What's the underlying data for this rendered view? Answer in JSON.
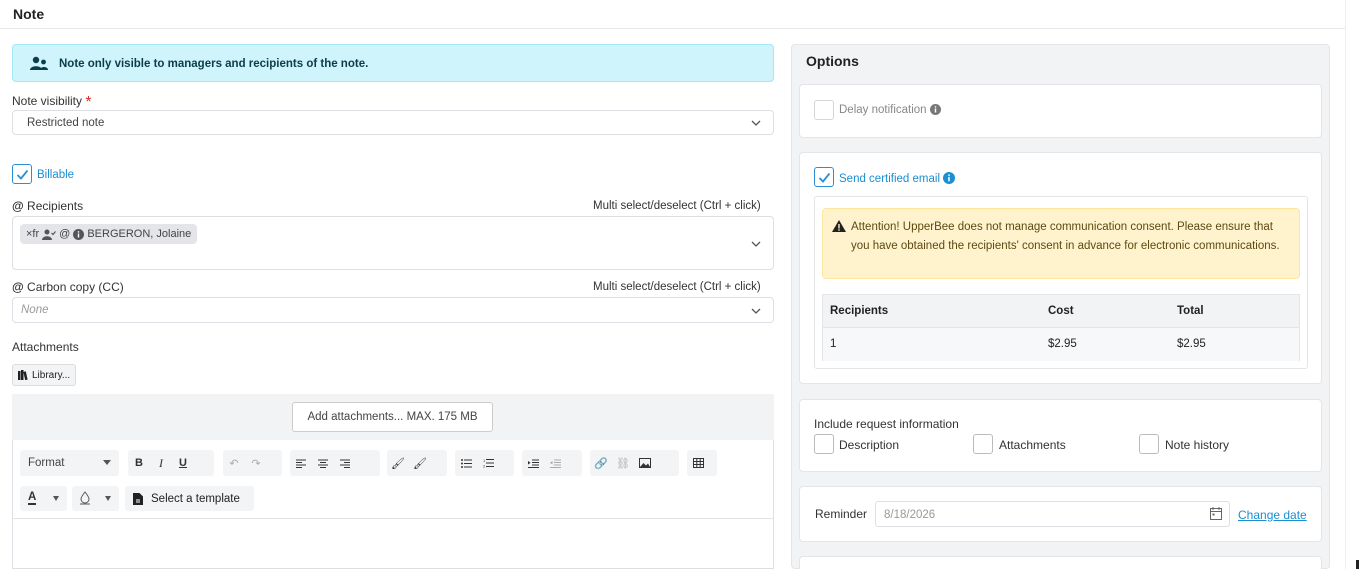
{
  "header": {
    "title": "Note"
  },
  "info_alert": {
    "text": "Note only visible to managers and recipients of the note."
  },
  "visibility": {
    "label": "Note visibility",
    "required_mark": "*",
    "value": "Restricted note"
  },
  "billable": {
    "label": "Billable",
    "checked": true
  },
  "recipients": {
    "label": "Recipients",
    "hint": "Multi select/deselect (Ctrl + click)",
    "tag": {
      "prefix": "×fr",
      "at": "@",
      "name": "BERGERON, Jolaine"
    }
  },
  "cc": {
    "label": "Carbon copy (CC)",
    "hint": "Multi select/deselect (Ctrl + click)",
    "placeholder": "None"
  },
  "attachments": {
    "label": "Attachments",
    "library_button": "Library...",
    "add_button": "Add attachments... MAX. 175 MB"
  },
  "editor": {
    "format_label": "Format",
    "template_button": "Select a template",
    "font_color_label": "A"
  },
  "options": {
    "title": "Options",
    "delay_notification": {
      "label": "Delay notification",
      "checked": false
    },
    "certified_email": {
      "label": "Send certified email",
      "checked": true,
      "warning": "Attention! UpperBee does not manage communication consent. Please ensure that you have obtained the recipients' consent in advance for electronic communications.",
      "table": {
        "headers": [
          "Recipients",
          "Cost",
          "Total"
        ],
        "rows": [
          [
            "1",
            "$2.95",
            "$2.95"
          ]
        ]
      }
    },
    "include_request": {
      "label": "Include request information",
      "items": [
        "Description",
        "Attachments",
        "Note history"
      ]
    },
    "reminder": {
      "label": "Reminder",
      "date": "8/18/2026",
      "change_link": "Change date"
    }
  },
  "colors": {
    "accent": "#1a8fd1",
    "info_bg": "#cff4fc",
    "warning_bg": "#fff3cd",
    "required": "#d32f2f"
  }
}
